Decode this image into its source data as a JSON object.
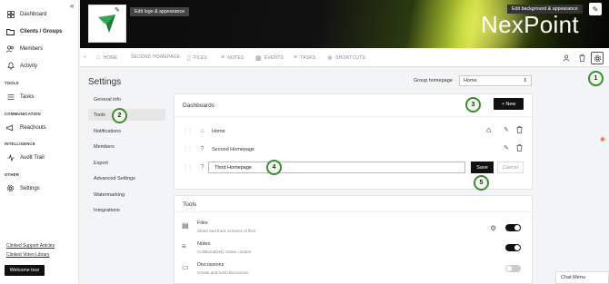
{
  "nav": {
    "items": [
      {
        "label": "Dashboard",
        "icon": "dashboard-icon"
      },
      {
        "label": "Clients / Groups",
        "icon": "folder-icon"
      },
      {
        "label": "Members",
        "icon": "members-icon"
      },
      {
        "label": "Activity",
        "icon": "bell-icon"
      }
    ],
    "sections": {
      "tools": "TOOLS",
      "communication": "COMMUNICATION",
      "intelligence": "INTELLIGENCE",
      "other": "OTHER"
    },
    "tasks": "Tasks",
    "reachouts": "Reachouts",
    "audit_trail": "Audit Trail",
    "settings": "Settings",
    "links": [
      "Clinked Support Articles",
      "Clinked Video Library"
    ],
    "welcome_tour": "Welcome tour",
    "collapse": "«"
  },
  "banner": {
    "edit_logo": "Edit logo & appearance",
    "edit_background": "Edit background & appearance",
    "brand_name": "NexPoint"
  },
  "tabs": [
    {
      "label": "HOME",
      "icon": "home-icon"
    },
    {
      "label": "SECOND HOMEPAGE"
    },
    {
      "label": "FILES",
      "icon": "file-icon"
    },
    {
      "label": "NOTES",
      "icon": "notes-icon"
    },
    {
      "label": "EVENTS",
      "icon": "calendar-icon"
    },
    {
      "label": "TASKS",
      "icon": "tasks-icon"
    },
    {
      "label": "SHORTCUTS",
      "icon": "plus-circle-icon"
    }
  ],
  "settings": {
    "title": "Settings",
    "group_homepage_label": "Group homepage",
    "group_homepage_value": "Home",
    "submenu": [
      "General info",
      "Tools",
      "Notifications",
      "Members",
      "Export",
      "Advanced Settings",
      "Watermarking",
      "Integrations"
    ]
  },
  "dashboards": {
    "title": "Dashboards",
    "new_label": "+ New",
    "rows": [
      {
        "name": "Home"
      },
      {
        "name": "Second Homepage"
      }
    ],
    "input_value": "Third Homepage",
    "save_label": "Save",
    "cancel_label": "Cancel"
  },
  "tools": {
    "title": "Tools",
    "items": [
      {
        "name": "Files",
        "desc": "Share and track versions of files",
        "on": true
      },
      {
        "name": "Notes",
        "desc": "Collaboratively create content",
        "on": true
      },
      {
        "name": "Discussions",
        "desc": "Create and hold discussions",
        "on": false
      }
    ]
  },
  "steps": [
    "1",
    "2",
    "3",
    "4",
    "5"
  ],
  "chat_menu": "Chat Menu",
  "colors": {
    "accent": "#3a8f2f",
    "brand_green": "#2fa84f",
    "banner_yellow": "#dfe84c"
  }
}
